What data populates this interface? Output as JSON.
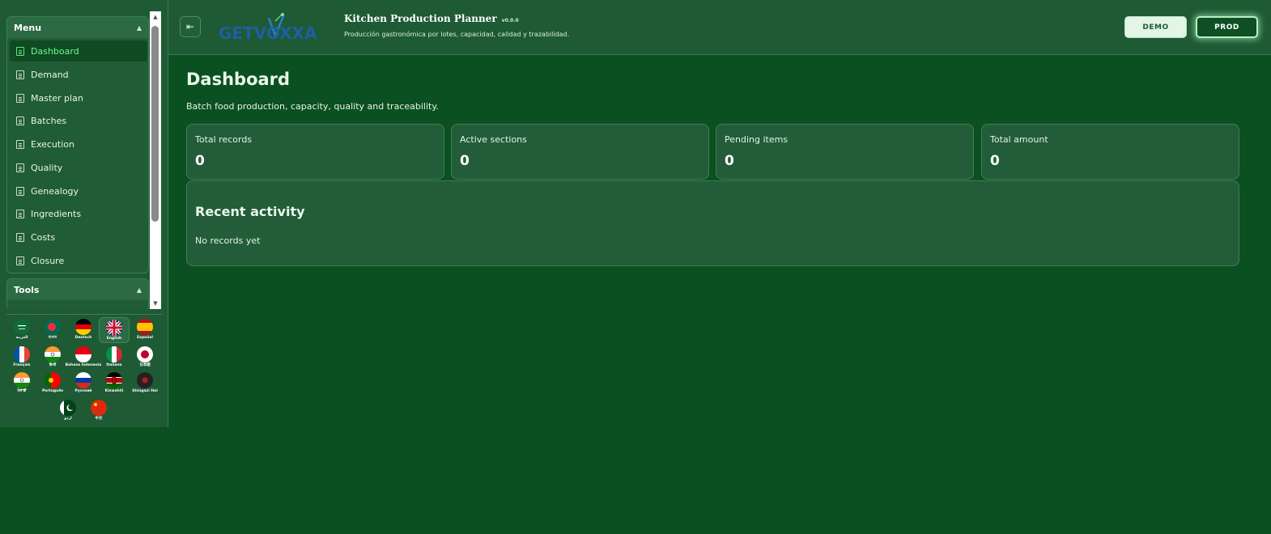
{
  "sidebar": {
    "menu_title": "Menu",
    "tools_title": "Tools",
    "items": [
      {
        "label": "Dashboard",
        "active": true
      },
      {
        "label": "Demand"
      },
      {
        "label": "Master plan"
      },
      {
        "label": "Batches"
      },
      {
        "label": "Execution"
      },
      {
        "label": "Quality"
      },
      {
        "label": "Genealogy"
      },
      {
        "label": "Ingredients"
      },
      {
        "label": "Costs"
      },
      {
        "label": "Closure"
      }
    ]
  },
  "languages": [
    {
      "label": "العربية",
      "icon": "saudi-flag-icon"
    },
    {
      "label": "বাংলা",
      "icon": "bangladesh-flag-icon"
    },
    {
      "label": "Deutsch",
      "icon": "germany-flag-icon"
    },
    {
      "label": "English",
      "icon": "uk-flag-icon",
      "active": true
    },
    {
      "label": "Español",
      "icon": "spain-flag-icon"
    },
    {
      "label": "Français",
      "icon": "france-flag-icon"
    },
    {
      "label": "हिन्दी",
      "icon": "india-flag-icon"
    },
    {
      "label": "Bahasa Indonesia",
      "icon": "indonesia-flag-icon"
    },
    {
      "label": "Italiano",
      "icon": "italy-flag-icon"
    },
    {
      "label": "日本語",
      "icon": "japan-flag-icon"
    },
    {
      "label": "ਪੰਜਾਬੀ",
      "icon": "india-flag-icon"
    },
    {
      "label": "Português",
      "icon": "portugal-flag-icon"
    },
    {
      "label": "Русский",
      "icon": "russia-flag-icon"
    },
    {
      "label": "Kiswahili",
      "icon": "kenya-flag-icon"
    },
    {
      "label": "Shingazi Hal",
      "icon": "dark-flag-icon"
    },
    {
      "label": "اردو",
      "icon": "pakistan-flag-icon"
    },
    {
      "label": "中文",
      "icon": "china-flag-icon"
    }
  ],
  "header": {
    "logo_text": "GETVOXXA",
    "app_title": "Kitchen Production Planner",
    "version": "v0.0.0",
    "subtitle": "Producción gastronómica por lotes, capacidad, calidad y trazabilidad.",
    "demo_label": "DEMO",
    "prod_label": "PROD"
  },
  "main": {
    "title": "Dashboard",
    "subtitle": "Batch food production, capacity, quality and traceability.",
    "stats": [
      {
        "label": "Total records",
        "value": "0"
      },
      {
        "label": "Active sections",
        "value": "0"
      },
      {
        "label": "Pending items",
        "value": "0"
      },
      {
        "label": "Total amount",
        "value": "0"
      }
    ],
    "activity_title": "Recent activity",
    "activity_empty": "No records yet"
  },
  "colors": {
    "background": "#0b5020",
    "panel": "#1e5a34",
    "active_text": "#6bff8f"
  }
}
